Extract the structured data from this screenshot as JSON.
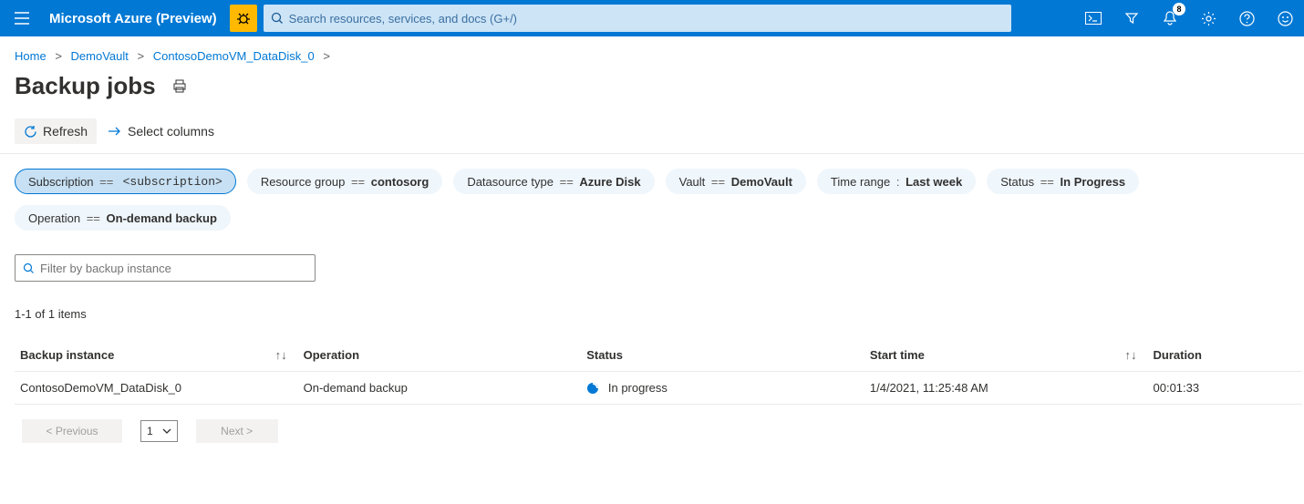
{
  "header": {
    "brand": "Microsoft Azure (Preview)",
    "search_placeholder": "Search resources, services, and docs (G+/)",
    "notification_count": "8"
  },
  "breadcrumb": {
    "items": [
      "Home",
      "DemoVault",
      "ContosoDemoVM_DataDisk_0"
    ]
  },
  "page": {
    "title": "Backup jobs"
  },
  "toolbar": {
    "refresh": "Refresh",
    "select_columns": "Select columns"
  },
  "filters": {
    "subscription": {
      "label": "Subscription",
      "op": "==",
      "value": "<subscription>"
    },
    "resource_group": {
      "label": "Resource group",
      "op": "==",
      "value": "contosorg"
    },
    "datasource": {
      "label": "Datasource type",
      "op": "==",
      "value": "Azure Disk"
    },
    "vault": {
      "label": "Vault",
      "op": "==",
      "value": "DemoVault"
    },
    "timerange": {
      "label": "Time range",
      "op": ":",
      "value": "Last week"
    },
    "status": {
      "label": "Status",
      "op": "==",
      "value": "In Progress"
    },
    "operation": {
      "label": "Operation",
      "op": "==",
      "value": "On-demand backup"
    }
  },
  "filter_input": {
    "placeholder": "Filter by backup instance"
  },
  "list": {
    "count_text": "1-1 of 1 items",
    "headers": {
      "instance": "Backup instance",
      "operation": "Operation",
      "status": "Status",
      "start": "Start time",
      "duration": "Duration"
    },
    "rows": [
      {
        "instance": "ContosoDemoVM_DataDisk_0",
        "operation": "On-demand backup",
        "status": "In progress",
        "start": "1/4/2021, 11:25:48 AM",
        "duration": "00:01:33"
      }
    ]
  },
  "pagination": {
    "prev": "< Previous",
    "page": "1",
    "next": "Next >"
  }
}
